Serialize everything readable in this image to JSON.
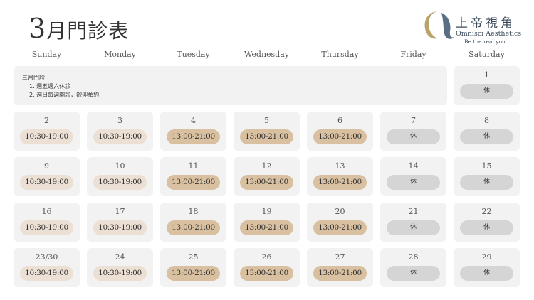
{
  "header": {
    "month_num": "3",
    "title_rest": "月門診表"
  },
  "brand": {
    "name_cn": "上帝視角",
    "name_en": "Omnisci Aesthetics",
    "tagline": "Be the real you",
    "logo_colors": [
      "#b8a46a",
      "#5a6f86"
    ]
  },
  "weekdays": [
    "Sunday",
    "Monday",
    "Tuesday",
    "Wednesday",
    "Thursday",
    "Friday",
    "Saturday"
  ],
  "note": {
    "title": "三月門診",
    "items": [
      "1. 週五週六休診",
      "2. 週日每週開診，歡迎預約"
    ]
  },
  "first_day": {
    "date": "1",
    "hours": "休",
    "kind": "closed"
  },
  "weeks": [
    [
      {
        "date": "2",
        "hours": "10:30-19:00",
        "kind": "morning"
      },
      {
        "date": "3",
        "hours": "10:30-19:00",
        "kind": "morning"
      },
      {
        "date": "4",
        "hours": "13:00-21:00",
        "kind": "afternoon"
      },
      {
        "date": "5",
        "hours": "13:00-21:00",
        "kind": "afternoon"
      },
      {
        "date": "6",
        "hours": "13:00-21:00",
        "kind": "afternoon"
      },
      {
        "date": "7",
        "hours": "休",
        "kind": "closed"
      },
      {
        "date": "8",
        "hours": "休",
        "kind": "closed"
      }
    ],
    [
      {
        "date": "9",
        "hours": "10:30-19:00",
        "kind": "morning"
      },
      {
        "date": "10",
        "hours": "10:30-19:00",
        "kind": "morning"
      },
      {
        "date": "11",
        "hours": "13:00-21:00",
        "kind": "afternoon"
      },
      {
        "date": "12",
        "hours": "13:00-21:00",
        "kind": "afternoon"
      },
      {
        "date": "13",
        "hours": "13:00-21:00",
        "kind": "afternoon"
      },
      {
        "date": "14",
        "hours": "休",
        "kind": "closed"
      },
      {
        "date": "15",
        "hours": "休",
        "kind": "closed"
      }
    ],
    [
      {
        "date": "16",
        "hours": "10:30-19:00",
        "kind": "morning"
      },
      {
        "date": "17",
        "hours": "10:30-19:00",
        "kind": "morning"
      },
      {
        "date": "18",
        "hours": "13:00-21:00",
        "kind": "afternoon"
      },
      {
        "date": "19",
        "hours": "13:00-21:00",
        "kind": "afternoon"
      },
      {
        "date": "20",
        "hours": "13:00-21:00",
        "kind": "afternoon"
      },
      {
        "date": "21",
        "hours": "休",
        "kind": "closed"
      },
      {
        "date": "22",
        "hours": "休",
        "kind": "closed"
      }
    ],
    [
      {
        "date": "23/30",
        "hours": "10:30-19:00",
        "kind": "morning"
      },
      {
        "date": "24",
        "hours": "10:30-19:00",
        "kind": "morning"
      },
      {
        "date": "25",
        "hours": "13:00-21:00",
        "kind": "afternoon"
      },
      {
        "date": "26",
        "hours": "13:00-21:00",
        "kind": "afternoon"
      },
      {
        "date": "27",
        "hours": "13:00-21:00",
        "kind": "afternoon"
      },
      {
        "date": "28",
        "hours": "休",
        "kind": "closed"
      },
      {
        "date": "29",
        "hours": "休",
        "kind": "closed"
      }
    ]
  ]
}
